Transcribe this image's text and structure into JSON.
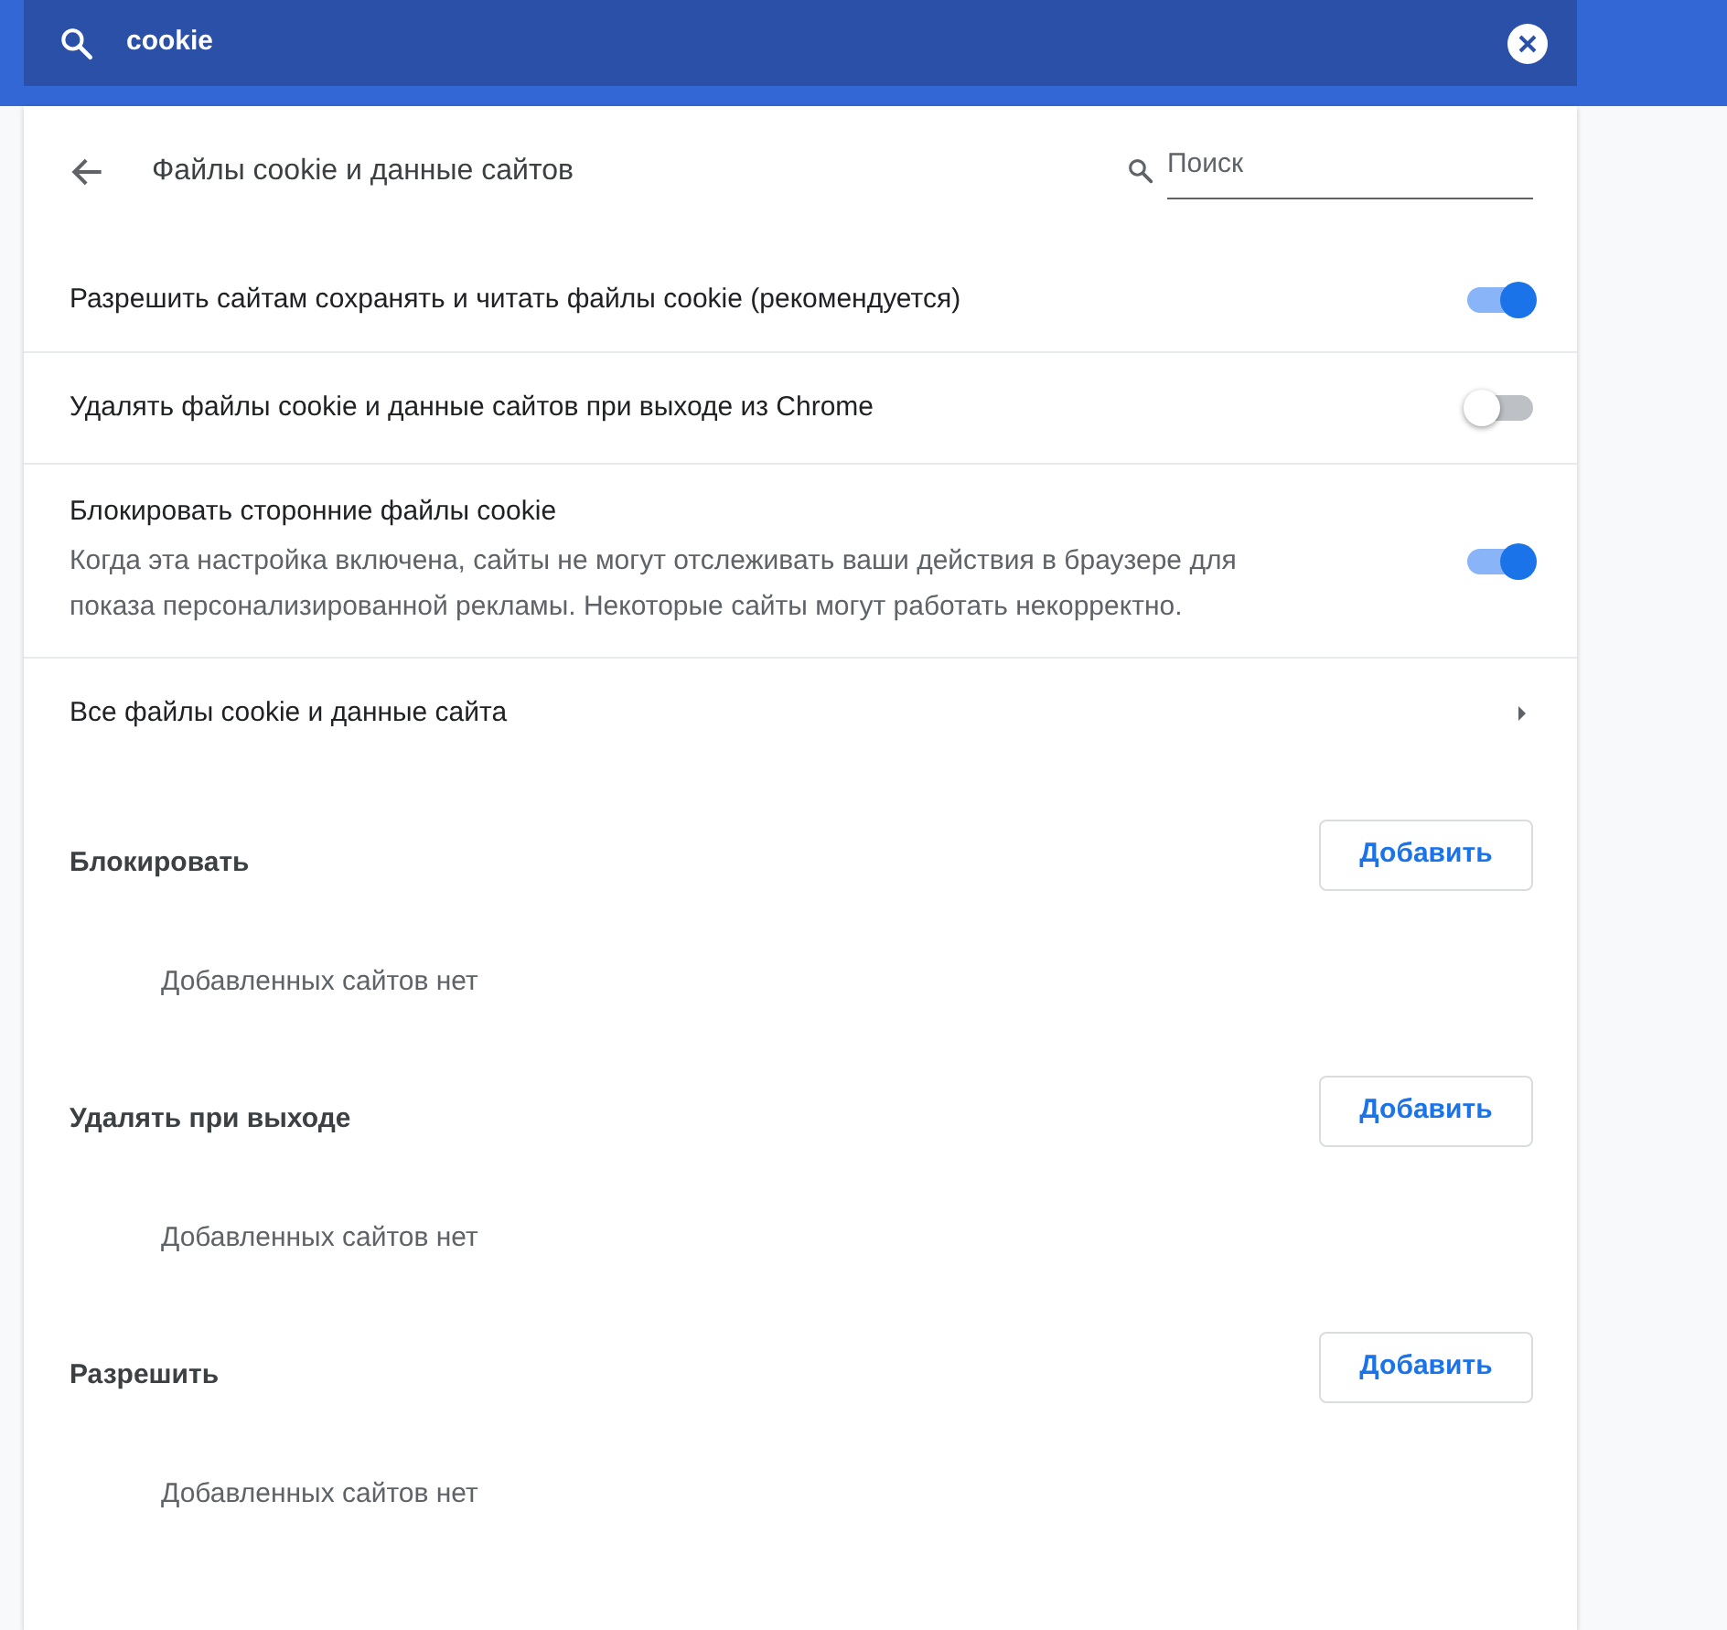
{
  "search": {
    "value": "cookie"
  },
  "page": {
    "title": "Файлы cookie и данные сайтов",
    "search": {
      "placeholder": "Поиск"
    }
  },
  "settings": [
    {
      "kind": "toggle",
      "label": "Разрешить сайтам сохранять и читать файлы cookie (рекомендуется)",
      "on": true
    },
    {
      "kind": "toggle",
      "label": "Удалять файлы cookie и данные сайтов при выходе из Chrome",
      "on": false
    },
    {
      "kind": "toggle",
      "label": "Блокировать сторонние файлы cookie",
      "description": "Когда эта настройка включена, сайты не могут отслеживать ваши действия в браузере для показа персонализированной рекламы. Некоторые сайты могут работать некорректно.",
      "on": true
    },
    {
      "kind": "link",
      "label": "Все файлы cookie и данные сайта"
    }
  ],
  "lists": [
    {
      "title": "Блокировать",
      "button": "Добавить",
      "empty": "Добавленных сайтов нет"
    },
    {
      "title": "Удалять при выходе",
      "button": "Добавить",
      "empty": "Добавленных сайтов нет"
    },
    {
      "title": "Разрешить",
      "button": "Добавить",
      "empty": "Добавленных сайтов нет"
    }
  ]
}
